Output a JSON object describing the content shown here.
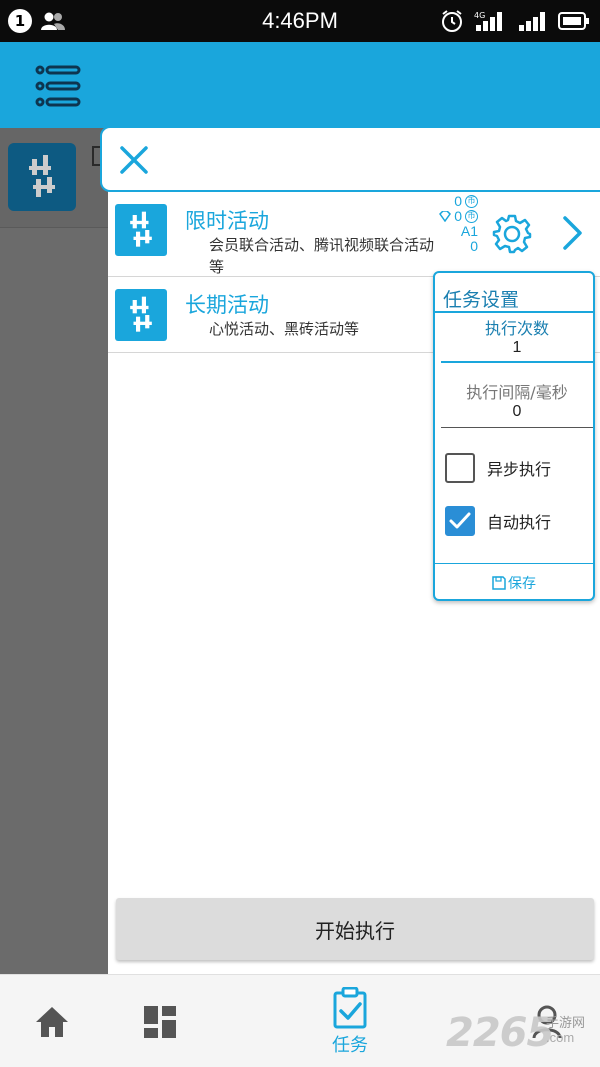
{
  "status_bar": {
    "notification_count": "1",
    "time": "4:46PM",
    "network_label": "4G"
  },
  "colors": {
    "accent": "#1aa6dc",
    "status_bar_bg": "#0b0b0b",
    "dim_overlay": "#6b6b6b",
    "checkbox_checked": "#2a8ed6"
  },
  "header": {
    "menu_icon": "list-menu-icon"
  },
  "drawer": {
    "close_icon": "close-icon",
    "items": [
      {
        "title": "限时活动",
        "description": "会员联合活动、腾讯视频联合活动等",
        "stats": [
          "0",
          "0",
          "A1",
          "0"
        ]
      },
      {
        "title": "长期活动",
        "description": "心悦活动、黑砖活动等"
      }
    ]
  },
  "task_settings": {
    "title": "任务设置",
    "exec_count_label": "执行次数",
    "exec_count_value": "1",
    "interval_label": "执行间隔/毫秒",
    "interval_value": "0",
    "async_label": "异步执行",
    "async_checked": false,
    "auto_label": "自动执行",
    "auto_checked": true,
    "save_label": "保存"
  },
  "start_button": {
    "label": "开始执行"
  },
  "bottom_nav": {
    "items": [
      {
        "icon": "home-icon",
        "label": ""
      },
      {
        "icon": "dashboard-icon",
        "label": ""
      },
      {
        "icon": "task-clipboard-icon",
        "label": "任务"
      },
      {
        "icon": "user-icon",
        "label": ""
      }
    ]
  },
  "watermark": {
    "number": "2265",
    "site": "手游网",
    "domain": ".com"
  }
}
